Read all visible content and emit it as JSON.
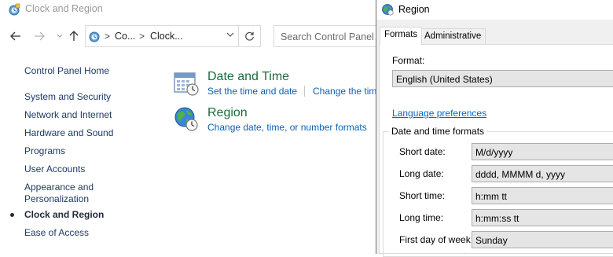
{
  "control_panel": {
    "window_title": "Clock and Region",
    "address": {
      "crumb_1": "Co...",
      "crumb_2": "Clock...",
      "separator": ">"
    },
    "search": {
      "placeholder": "Search Control Panel"
    },
    "sidebar": {
      "home": "Control Panel Home",
      "items": [
        {
          "label": "System and Security"
        },
        {
          "label": "Network and Internet"
        },
        {
          "label": "Hardware and Sound"
        },
        {
          "label": "Programs"
        },
        {
          "label": "User Accounts"
        },
        {
          "label": "Appearance and"
        },
        {
          "label": "Personalization"
        },
        {
          "label": "Clock and Region",
          "current": true
        },
        {
          "label": "Ease of Access"
        }
      ]
    },
    "categories": {
      "date_time": {
        "title": "Date and Time",
        "links": [
          "Set the time and date",
          "Change the tim"
        ]
      },
      "region": {
        "title": "Region",
        "links": [
          "Change date, time, or number formats"
        ]
      }
    }
  },
  "region_dialog": {
    "title": "Region",
    "tabs": [
      "Formats",
      "Administrative"
    ],
    "active_tab": "Formats",
    "format_label": "Format:",
    "format_value": "English (United States)",
    "language_prefs_link": "Language preferences",
    "date_time_group": {
      "title": "Date and time formats",
      "rows": [
        {
          "label": "Short date:",
          "value": "M/d/yyyy"
        },
        {
          "label": "Long date:",
          "value": "dddd, MMMM d, yyyy"
        },
        {
          "label": "Short time:",
          "value": "h:mm tt"
        },
        {
          "label": "Long time:",
          "value": "h:mm:ss tt"
        },
        {
          "label": "First day of week:",
          "value": "Sunday"
        }
      ]
    }
  },
  "colors": {
    "link_blue": "#0b5fb3",
    "category_green": "#1e6b3d",
    "sidebar_text": "#1e3a66",
    "dialog_bg": "#f0f0f0"
  },
  "icons": {
    "window": "control-panel-icon",
    "date_time": "calendar-clock-icon",
    "region": "globe-clock-icon"
  }
}
